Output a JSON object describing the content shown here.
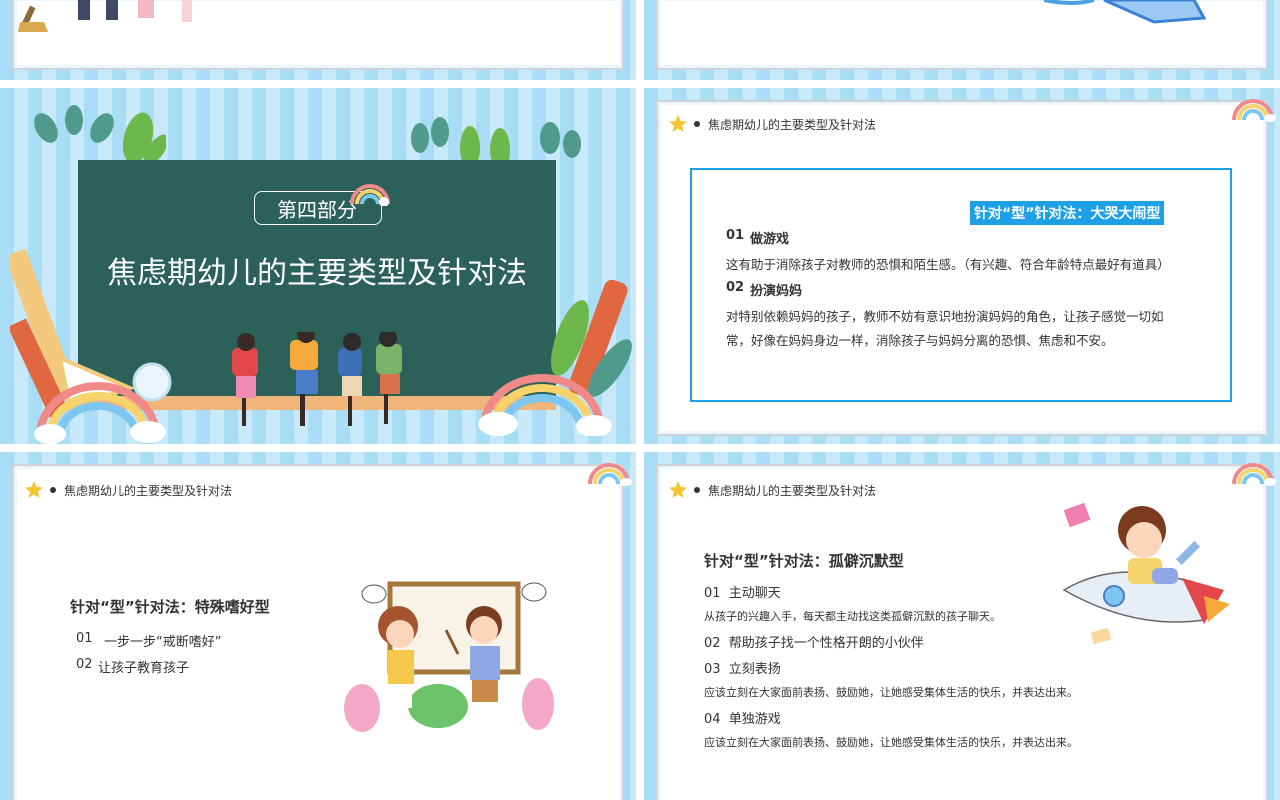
{
  "colors": {
    "stripe_dark": "#a9dcf5",
    "stripe_light": "#c7e9fa",
    "chalkboard": "#2b6158",
    "accent_blue": "#1ea0e6",
    "rainbow_red": "#f08a8a",
    "rainbow_yellow": "#f7d36b",
    "rainbow_blue": "#7cc6f0"
  },
  "section_slide": {
    "part_label": "第四部分",
    "title": "焦虑期幼儿的主要类型及针对法"
  },
  "header_title": "焦虑期幼儿的主要类型及针对法",
  "slide_crying": {
    "badge": "针对“型”针对法：大哭大闹型",
    "items": [
      {
        "num": "01",
        "title": "做游戏",
        "desc_lines": [
          "这有助于消除孩子对教师的恐惧和陌生感。（有兴趣、符合年龄特点最好有道具）"
        ]
      },
      {
        "num": "02",
        "title": "扮演妈妈",
        "desc_lines": [
          "对特别依赖妈妈的孩子，教师不妨有意识地扮演妈妈的角色，让孩子感觉一切如",
          "常，好像在妈妈身边一样，消除孩子与妈妈分离的恐惧、焦虑和不安。"
        ]
      }
    ]
  },
  "slide_habit": {
    "heading": "针对“型”针对法：特殊嗜好型",
    "items": [
      {
        "num": "01",
        "text": "一步一步“戒断嗜好”"
      },
      {
        "num": "02",
        "text": "让孩子教育孩子"
      }
    ]
  },
  "slide_silent": {
    "heading": "针对“型”针对法：孤僻沉默型",
    "items": [
      {
        "label": "01  主动聊天",
        "desc": "从孩子的兴趣入手，每天都主动找这类孤僻沉默的孩子聊天。"
      },
      {
        "label": "02  帮助孩子找一个性格开朗的小伙伴",
        "desc": ""
      },
      {
        "label": "03  立刻表扬",
        "desc": "应该立刻在大家面前表扬、鼓励她，让她感受集体生活的快乐，并表达出来。"
      },
      {
        "label": "04  单独游戏",
        "desc": "应该立刻在大家面前表扬、鼓励她，让她感受集体生活的快乐，并表达出来。"
      }
    ]
  }
}
